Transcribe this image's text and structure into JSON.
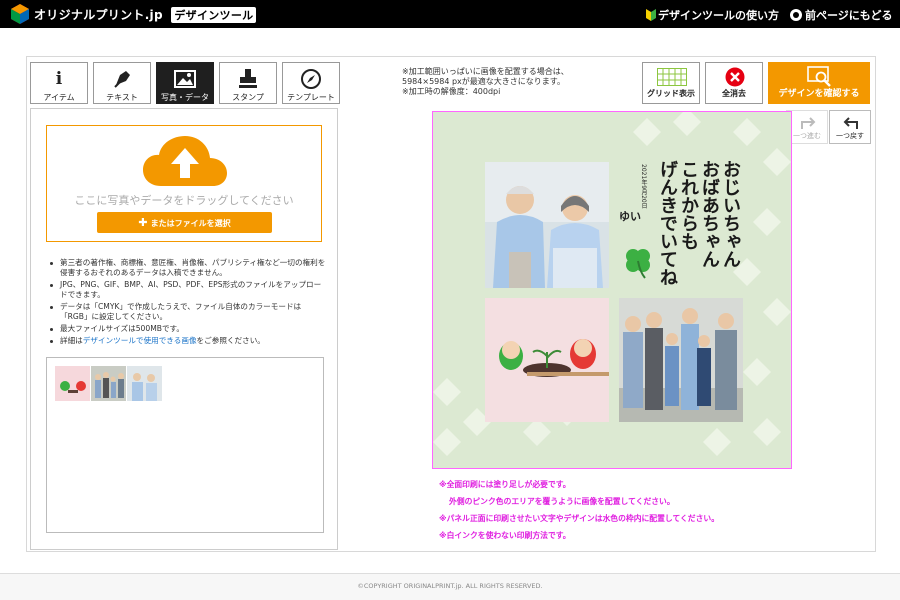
{
  "header": {
    "brand": "オリジナルプリント.jp",
    "tool_title": "デザインツール",
    "howto": "デザインツールの使い方",
    "back": "前ページにもどる"
  },
  "tabs": [
    {
      "label": "アイテム",
      "icon": "info-icon",
      "active": false
    },
    {
      "label": "テキスト",
      "icon": "pen-icon",
      "active": false
    },
    {
      "label": "写真・データ",
      "icon": "image-icon",
      "active": true
    },
    {
      "label": "スタンプ",
      "icon": "stamp-icon",
      "active": false
    },
    {
      "label": "テンプレート",
      "icon": "compass-icon",
      "active": false
    }
  ],
  "notice": [
    "※加工範囲いっぱいに画像を配置する場合は、",
    "5984×5984 pxが最適な大きさになります。",
    "※加工時の解像度：400dpi"
  ],
  "toolbar": {
    "grid_label": "グリッド表示",
    "clear_label": "全消去",
    "confirm_label": "デザインを確認する",
    "redo_label": "一つ進む",
    "undo_label": "一つ戻す"
  },
  "upload": {
    "drop_text": "ここに写真やデータをドラッグしてください",
    "select_button": "またはファイルを選択"
  },
  "notes": {
    "n1": "第三者の著作権、商標権、意匠権、肖像権、パブリシティ権など一切の権利を侵害するおそれのあるデータは入稿できません。",
    "n2": "JPG、PNG、GIF、BMP、AI、PSD、PDF、EPS形式のファイルをアップロードできます。",
    "n3": "データは「CMYK」で作成したうえで、ファイル自体のカラーモードは「RGB」に設定してください。",
    "n4": "最大ファイルサイズは500MBです。",
    "n5_pre": "詳細は",
    "n5_link": "デザインツールで使用できる画像",
    "n5_post": "をご参照ください。"
  },
  "canvas": {
    "calligraphy": [
      "おじいちゃん",
      "おばあちゃん",
      "これからも",
      "げんきでいてね"
    ],
    "date": "2021年9月20日",
    "signature": "ゆい"
  },
  "warnings": [
    "※全面印刷には塗り足しが必要です。",
    "外側のピンク色のエリアを覆うように画像を配置してください。",
    "※パネル正面に印刷させたい文字やデザインは水色の枠内に配置してください。",
    "※白インクを使わない印刷方法です。"
  ],
  "footer": "©COPYRIGHT ORIGINALPRINT.jp. ALL RIGHTS RESERVED.",
  "colors": {
    "accent": "#f39800",
    "active_tab": "#1f1f1f",
    "clear_red": "#e60012",
    "warning_pink": "#e020e0",
    "canvas_bg": "#dce9d2",
    "link": "#1a73c8"
  }
}
